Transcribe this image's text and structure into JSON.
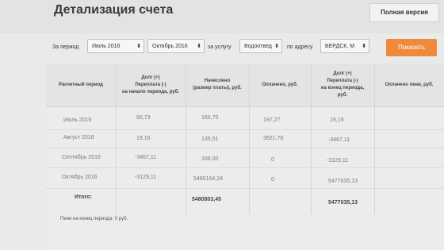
{
  "header": {
    "title": "Детализация счета",
    "full_version_label": "Полная версия"
  },
  "filters": {
    "period_label": "За период",
    "period_from": "Июль 2016",
    "period_to": "Октябрь 2016",
    "service_label": "за услугу",
    "service_value": "Водоотвед",
    "address_label": "по адресу",
    "address_value": "БЕРДСК, М",
    "show_button": "Показать"
  },
  "table": {
    "columns": [
      "Расчетный период",
      "Долг (+)\nПереплата (-)\nна начало периода, руб.",
      "Начислено\n(размер платы), руб.",
      "Оплачено, руб.",
      "Долг (+)\nПереплата (-)\nна конец периода,\nруб.",
      "Оплачено пени, руб."
    ],
    "rows": [
      {
        "period": "Июль 2016",
        "debt_start": "50,73",
        "charged": "165,70",
        "paid": "197,27",
        "debt_end": "19,16",
        "penalty_paid": ""
      },
      {
        "period": "Август 2016",
        "debt_start": "19,16",
        "charged": "135,51",
        "paid": "3621,78",
        "debt_end": "-3467,11",
        "penalty_paid": ""
      },
      {
        "period": "Сентябрь 2016",
        "debt_start": "-3467,11",
        "charged": "338,00",
        "paid": "0",
        "debt_end": "-3129,11",
        "penalty_paid": ""
      },
      {
        "period": "Октябрь 2016",
        "debt_start": "-3129,11",
        "charged": "5480164,24",
        "paid": "0",
        "debt_end": "5477035,13",
        "penalty_paid": ""
      }
    ],
    "total": {
      "label": "Итого:",
      "charged": "5480803,45",
      "debt_end": "5477035,13"
    }
  },
  "footer": {
    "penalty_note": "Пени на конец периода: 0 руб."
  }
}
